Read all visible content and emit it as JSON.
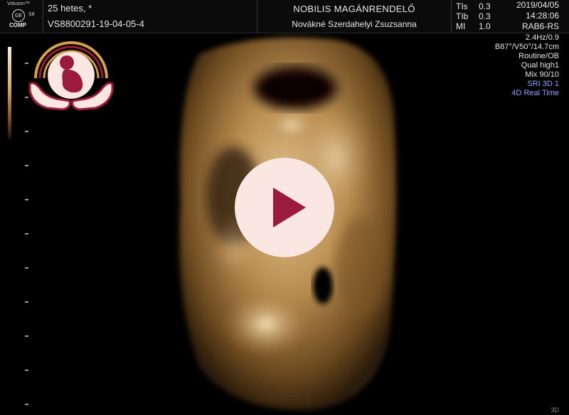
{
  "header": {
    "brand_small": "Voluson™",
    "brand_logo": "GE",
    "brand_model": "S8",
    "brand_comp": "COMP",
    "patient_line": "25 hetes,     *",
    "patient_id": "VS8800291-19-04-05-4",
    "clinic_name": "NOBILIS MAGÁNRENDELŐ",
    "doctor_name": "Novákné Szerdahelyi Zsuzsanna",
    "params": [
      {
        "label": "TIs",
        "value": "0.3"
      },
      {
        "label": "TIb",
        "value": "0.3"
      },
      {
        "label": "MI",
        "value": "1.0"
      }
    ],
    "date": "2019/04/05",
    "time": "14:28:06",
    "probe": "RAB6-RS"
  },
  "settings": {
    "line1": "2.4Hz/0.9",
    "line2": "B87°/V50°/14.7cm",
    "line3": "Routine/OB",
    "line4": "Qual high1",
    "line5": "Mix 90/10",
    "line6": "SRI 3D 1",
    "line7": "4D Real Time"
  },
  "corner_label": "3D",
  "colors": {
    "accent": "#9b1b3a",
    "play_bg": "#fbe7e2",
    "logo_gold": "#d4a04c",
    "setting_blue": "#8aa5ff"
  },
  "icons": {
    "play": "play-icon",
    "logo": "fetus-hands-logo"
  }
}
